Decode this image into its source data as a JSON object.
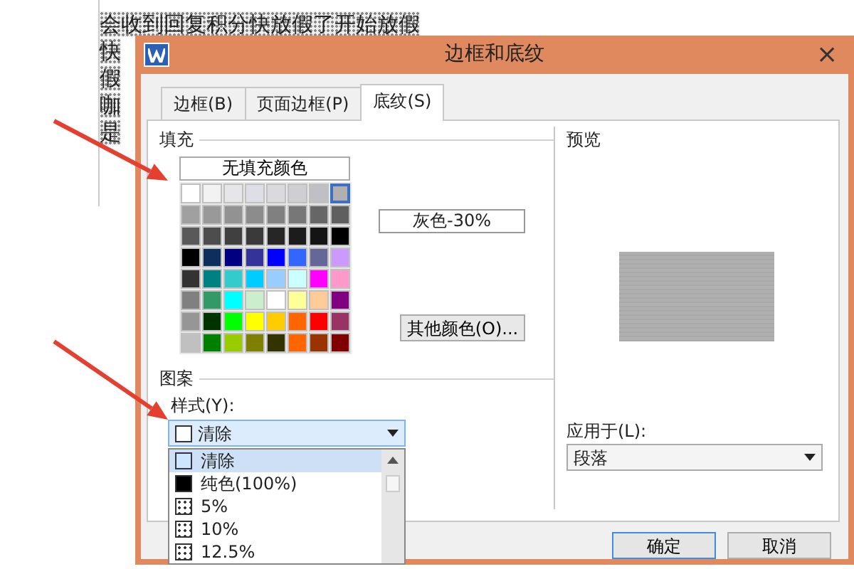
{
  "document": {
    "lines": [
      "会收到回复积分快放假了开始放假",
      "快",
      "假",
      "咖",
      "是"
    ]
  },
  "dialog": {
    "title": "边框和底纹",
    "close": "×",
    "tabs": [
      {
        "label": "边框(B)",
        "selected": false
      },
      {
        "label": "页面边框(P)",
        "selected": false
      },
      {
        "label": "底纹(S)",
        "selected": true
      }
    ],
    "fill": {
      "label": "填充",
      "no_fill_button": "无填充颜色",
      "swatches": [
        {
          "color": "#ffffff",
          "selected": false
        },
        {
          "color": "#f2f2f2",
          "selected": false
        },
        {
          "color": "#e6e6ea",
          "selected": false
        },
        {
          "color": "#dedfe6",
          "selected": false
        },
        {
          "color": "#d9d9de",
          "selected": false
        },
        {
          "color": "#cfcfd3",
          "selected": false
        },
        {
          "color": "#bfbfc4",
          "selected": false
        },
        {
          "color": "#b0b0b0",
          "selected": true
        },
        {
          "color": "#a0a0a0",
          "selected": false
        },
        {
          "color": "#999999",
          "selected": false
        },
        {
          "color": "#929292",
          "selected": false
        },
        {
          "color": "#8c8c8c",
          "selected": false
        },
        {
          "color": "#808080",
          "selected": false
        },
        {
          "color": "#777777",
          "selected": false
        },
        {
          "color": "#666666",
          "selected": false
        },
        {
          "color": "#5f5f5f",
          "selected": false
        },
        {
          "color": "#595959",
          "selected": false
        },
        {
          "color": "#4d4d4d",
          "selected": false
        },
        {
          "color": "#404040",
          "selected": false
        },
        {
          "color": "#3a3a3a",
          "selected": false
        },
        {
          "color": "#262626",
          "selected": false
        },
        {
          "color": "#1c1c1c",
          "selected": false
        },
        {
          "color": "#141414",
          "selected": false
        },
        {
          "color": "#000000",
          "selected": false
        },
        {
          "color": "#000000",
          "selected": false
        },
        {
          "color": "#0d2f60",
          "selected": false
        },
        {
          "color": "#000080",
          "selected": false
        },
        {
          "color": "#333399",
          "selected": false
        },
        {
          "color": "#0000ff",
          "selected": false
        },
        {
          "color": "#3366ff",
          "selected": false
        },
        {
          "color": "#666699",
          "selected": false
        },
        {
          "color": "#cc99ff",
          "selected": false
        },
        {
          "color": "#333333",
          "selected": false
        },
        {
          "color": "#008080",
          "selected": false
        },
        {
          "color": "#33cccc",
          "selected": false
        },
        {
          "color": "#00ccff",
          "selected": false
        },
        {
          "color": "#99ccff",
          "selected": false
        },
        {
          "color": "#ccffff",
          "selected": false
        },
        {
          "color": "#ff00ff",
          "selected": false
        },
        {
          "color": "#ff99cc",
          "selected": false
        },
        {
          "color": "#808080",
          "selected": false
        },
        {
          "color": "#339966",
          "selected": false
        },
        {
          "color": "#00ffff",
          "selected": false
        },
        {
          "color": "#cceecc",
          "selected": false
        },
        {
          "color": "#ffffff",
          "selected": false
        },
        {
          "color": "#ffff99",
          "selected": false
        },
        {
          "color": "#ffcc99",
          "selected": false
        },
        {
          "color": "#800080",
          "selected": false
        },
        {
          "color": "#969696",
          "selected": false
        },
        {
          "color": "#003300",
          "selected": false
        },
        {
          "color": "#00ff00",
          "selected": false
        },
        {
          "color": "#ffff00",
          "selected": false
        },
        {
          "color": "#ffcc00",
          "selected": false
        },
        {
          "color": "#ff6600",
          "selected": false
        },
        {
          "color": "#ff0000",
          "selected": false
        },
        {
          "color": "#993366",
          "selected": false
        },
        {
          "color": "#c0c0c0",
          "selected": false
        },
        {
          "color": "#008000",
          "selected": false
        },
        {
          "color": "#99cc00",
          "selected": false
        },
        {
          "color": "#808000",
          "selected": false
        },
        {
          "color": "#333300",
          "selected": false
        },
        {
          "color": "#ff6600",
          "selected": false
        },
        {
          "color": "#993300",
          "selected": false
        },
        {
          "color": "#800000",
          "selected": false
        }
      ],
      "color_name": "灰色-30%",
      "more_colors_button": "其他颜色(O)..."
    },
    "pattern": {
      "label": "图案",
      "style_label": "样式(Y):",
      "style_value": "清除",
      "expanded": true,
      "options": [
        {
          "label": "清除",
          "kind": "clear",
          "selected": true
        },
        {
          "label": "纯色(100%)",
          "kind": "solid",
          "selected": false
        },
        {
          "label": "5%",
          "kind": "dots",
          "selected": false
        },
        {
          "label": "10%",
          "kind": "dots",
          "selected": false
        },
        {
          "label": "12.5%",
          "kind": "dots",
          "selected": false
        }
      ]
    },
    "preview": {
      "label": "预览"
    },
    "apply_to": {
      "label": "应用于(L):",
      "value": "段落"
    },
    "buttons": [
      {
        "label": "确定",
        "default": true
      },
      {
        "label": "取消",
        "default": false
      }
    ]
  }
}
